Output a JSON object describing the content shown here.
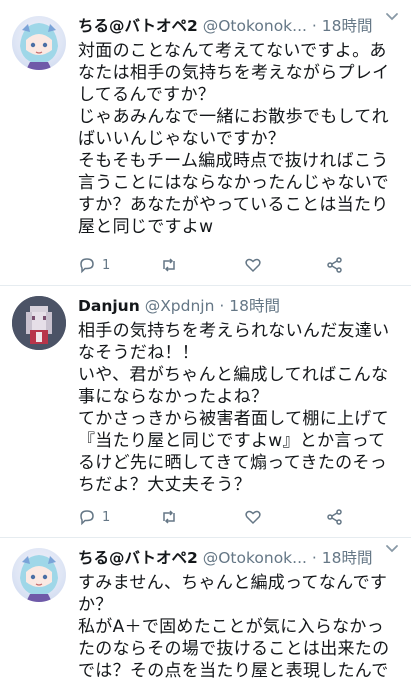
{
  "tweets": [
    {
      "name": "ちる@バトオペ2",
      "handle": "@Otokonok...",
      "dot": "·",
      "time": "18時間",
      "body": "対面のことなんて考えてないですよ。あなたは相手の気持ちを考えながらプレイしてるんですか？\nじゃあみんなで一緒にお散歩でもしてればいいんじゃないですか？\nそもそもチーム編成時点で抜ければこう言うことにはならなかったんじゃないですか？あなたがやっていることは当たり屋と同じですよw",
      "reply_count": "1"
    },
    {
      "name": "Danjun",
      "handle": "@Xpdnjn",
      "dot": "·",
      "time": "18時間",
      "body": "相手の気持ちを考えられないんだ友達いなそうだね！！\nいや、君がちゃんと編成してればこんな事にならなかったよね？\nてかさっきから被害者面して棚に上げて『当たり屋と同じですよw』とか言ってるけど先に晒してきて煽ってきたのそっちだよ？大丈夫そう？",
      "reply_count": "1"
    },
    {
      "name": "ちる@バトオペ2",
      "handle": "@Otokonok...",
      "dot": "·",
      "time": "18時間",
      "body": "すみません、ちゃんと編成ってなんですか？\n私がA＋で固めたことが気に入らなかったのならその場で抜けることは出来たのでは？その点を当たり屋と表現したんです"
    }
  ],
  "icons": {
    "reply": "reply-icon",
    "retweet": "retweet-icon",
    "like": "like-icon",
    "share": "share-icon",
    "caret": "chevron-down-icon"
  },
  "colors": {
    "text": "#14171a",
    "secondary": "#657786",
    "divider": "#e6ecf0"
  }
}
